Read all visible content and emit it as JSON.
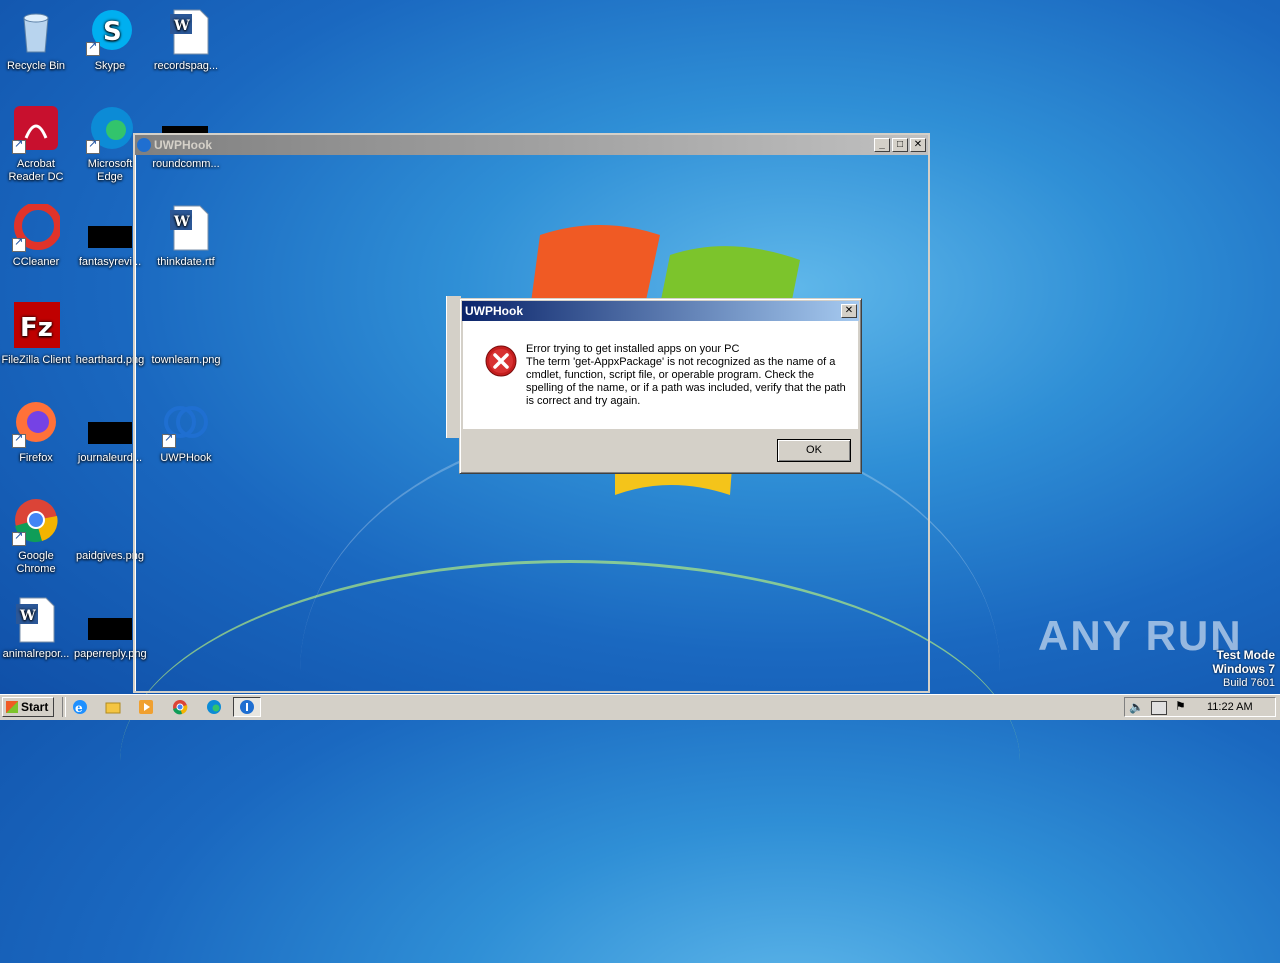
{
  "desktop": {
    "icons": [
      {
        "label": "Recycle Bin"
      },
      {
        "label": "Skype"
      },
      {
        "label": "recordspag..."
      },
      {
        "label": "Acrobat Reader DC"
      },
      {
        "label": "Microsoft Edge"
      },
      {
        "label": "roundcomm..."
      },
      {
        "label": "CCleaner"
      },
      {
        "label": "fantasyrevi..."
      },
      {
        "label": "thinkdate.rtf"
      },
      {
        "label": "FileZilla Client"
      },
      {
        "label": "hearthard.png"
      },
      {
        "label": "townlearn.png"
      },
      {
        "label": "Firefox"
      },
      {
        "label": "journaleurd..."
      },
      {
        "label": "UWPHook"
      },
      {
        "label": "Google Chrome"
      },
      {
        "label": "paidgives.png"
      },
      {
        "label": "animalrepor..."
      },
      {
        "label": "paperreply.png"
      }
    ]
  },
  "main_window": {
    "title": "UWPHook",
    "buttons": {
      "minimize": "_",
      "maximize": "□",
      "close": "✕"
    }
  },
  "dialog": {
    "title": "UWPHook",
    "close": "✕",
    "message_line1": "Error trying to get installed apps on your PC",
    "message_line2": "The term 'get-AppxPackage' is not recognized as the name of a cmdlet, function, script file, or operable program. Check the spelling of the name, or if a path was included, verify that the path is correct and try again.",
    "ok_label": "OK",
    "icon": "error-icon"
  },
  "taskbar": {
    "start_label": "Start",
    "clock": "11:22 AM"
  },
  "watermark": {
    "brand": "ANY RUN",
    "line1": "Test Mode",
    "line2": "Windows 7",
    "line3": "Build 7601"
  }
}
